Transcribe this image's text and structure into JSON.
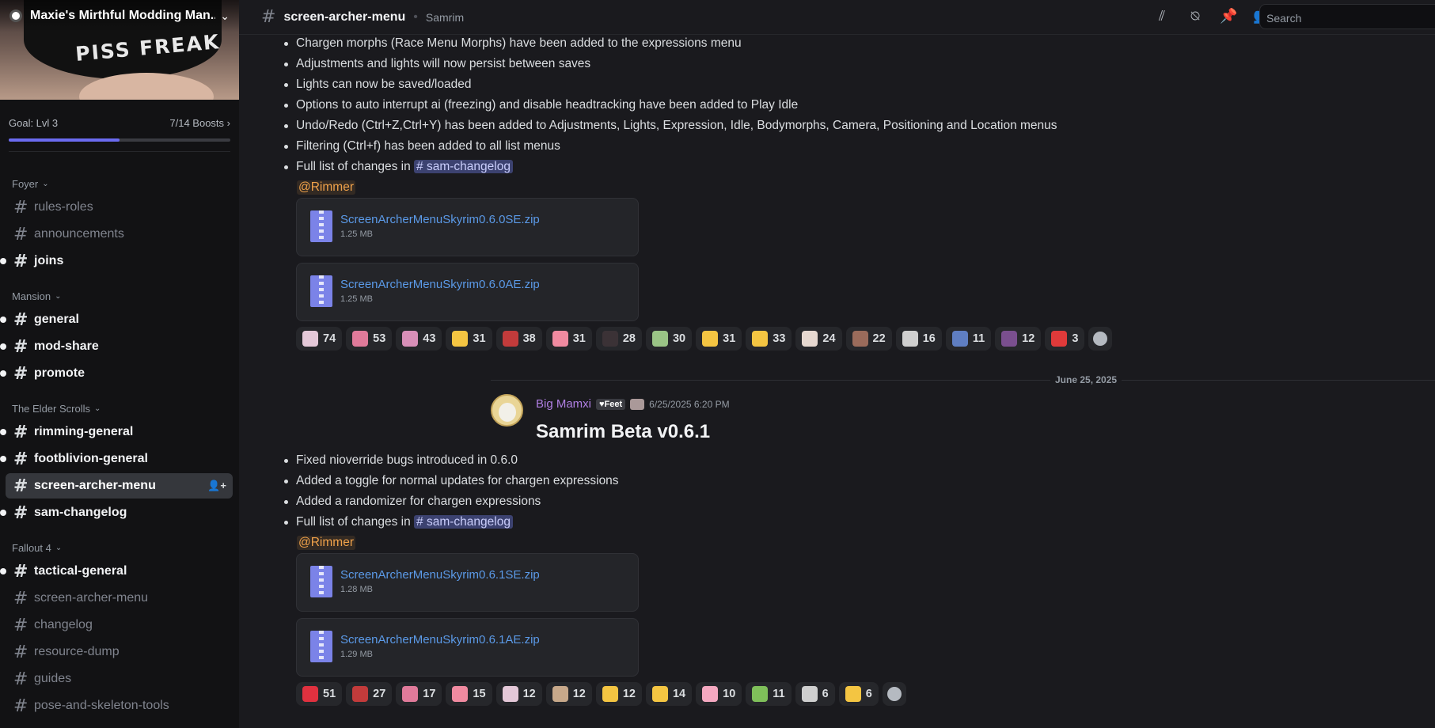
{
  "server": {
    "name": "Maxie's Mirthful Modding Man...",
    "banner_text": "PISS FREAK"
  },
  "boost": {
    "goal": "Goal: Lvl 3",
    "progress_label": "7/14 Boosts",
    "progress": 0.5
  },
  "categories": {
    "foyer": "Foyer",
    "mansion": "Mansion",
    "elder": "The Elder Scrolls",
    "fallout": "Fallout 4"
  },
  "channels": {
    "rules_roles": "rules-roles",
    "announcements": "announcements",
    "joins": "joins",
    "general": "general",
    "mod_share": "mod-share",
    "promote": "promote",
    "rimming_general": "rimming-general",
    "footblivion_general": "footblivion-general",
    "screen_archer_menu": "screen-archer-menu",
    "sam_changelog": "sam-changelog",
    "tactical_general": "tactical-general",
    "fo4_screen_archer": "screen-archer-menu",
    "changelog": "changelog",
    "resource_dump": "resource-dump",
    "guides": "guides",
    "pose_tools": "pose-and-skeleton-tools"
  },
  "header": {
    "hash": "#",
    "channel": "screen-archer-menu",
    "topic": "Samrim",
    "search_placeholder": "Search"
  },
  "post1": {
    "bullets": [
      "Chargen morphs (Race Menu Morphs) have been added to the expressions menu",
      "Adjustments and lights will now persist between saves",
      "Lights can now be saved/loaded",
      "Options to auto interrupt ai (freezing) and disable headtracking have been added to Play Idle",
      "Undo/Redo (Ctrl+Z,Ctrl+Y) has been added to Adjustments, Lights, Expression, Idle, Bodymorphs, Camera, Positioning and Location menus",
      "Filtering (Ctrl+f) has been added to all list menus"
    ],
    "changes_prefix": "Full list of changes in",
    "changelog_link": "# sam-changelog",
    "mention": "@Rimmer",
    "attachments": [
      {
        "name": "ScreenArcherMenuSkyrim0.6.0SE.zip",
        "size": "1.25 MB"
      },
      {
        "name": "ScreenArcherMenuSkyrim0.6.0AE.zip",
        "size": "1.25 MB"
      }
    ],
    "reactions": [
      {
        "icon": "anime-face-emoji",
        "count": "74",
        "color": "#e4c8d8"
      },
      {
        "icon": "anime-blush-emoji",
        "count": "53",
        "color": "#e07a9a"
      },
      {
        "icon": "anime-girl-emoji",
        "count": "43",
        "color": "#d88fb8"
      },
      {
        "icon": "crying-emoji",
        "count": "31",
        "color": "#f4c542"
      },
      {
        "icon": "lips-emoji",
        "count": "38",
        "color": "#c23b3b"
      },
      {
        "icon": "pink-cone-emoji",
        "count": "31",
        "color": "#f08aa0"
      },
      {
        "icon": "dark-face-emoji",
        "count": "28",
        "color": "#3b3236"
      },
      {
        "icon": "flower-girl-emoji",
        "count": "30",
        "color": "#9ac486"
      },
      {
        "icon": "shush-emoji",
        "count": "31",
        "color": "#f4c542"
      },
      {
        "icon": "thumbs-up-emoji",
        "count": "33",
        "color": "#f4c542"
      },
      {
        "icon": "pale-face-emoji",
        "count": "24",
        "color": "#e6d8d0"
      },
      {
        "icon": "helmet-emoji",
        "count": "22",
        "color": "#9a6b5b"
      },
      {
        "icon": "sketch-face-emoji",
        "count": "16",
        "color": "#cfcfcf"
      },
      {
        "icon": "blue-hair-emoji",
        "count": "11",
        "color": "#5f7ec2"
      },
      {
        "icon": "anime-kiss-emoji",
        "count": "12",
        "color": "#7a4f8f"
      },
      {
        "icon": "flag-emoji",
        "count": "3",
        "color": "#e03a3a"
      }
    ]
  },
  "divider_date": "June 25, 2025",
  "post2": {
    "author": "Big Mamxi",
    "tag": "♥Feet",
    "timestamp": "6/25/2025 6:20 PM",
    "title": "Samrim Beta v0.6.1",
    "bullets": [
      "Fixed nioverride bugs introduced in 0.6.0",
      "Added a toggle for normal updates for chargen expressions",
      "Added a randomizer for chargen expressions"
    ],
    "changes_prefix": "Full list of changes in",
    "changelog_link": "# sam-changelog",
    "mention": "@Rimmer",
    "attachments": [
      {
        "name": "ScreenArcherMenuSkyrim0.6.1SE.zip",
        "size": "1.28 MB"
      },
      {
        "name": "ScreenArcherMenuSkyrim0.6.1AE.zip",
        "size": "1.29 MB"
      }
    ],
    "reactions": [
      {
        "icon": "heart-emoji",
        "count": "51",
        "color": "#e0313f"
      },
      {
        "icon": "lips-emoji",
        "count": "27",
        "color": "#c23b3b"
      },
      {
        "icon": "anime-blush-emoji",
        "count": "17",
        "color": "#e07a9a"
      },
      {
        "icon": "pink-cone-emoji",
        "count": "15",
        "color": "#f08aa0"
      },
      {
        "icon": "anime-face-emoji",
        "count": "12",
        "color": "#e4c8d8"
      },
      {
        "icon": "sketch-girl-emoji",
        "count": "12",
        "color": "#c7a88a"
      },
      {
        "icon": "shades-emoji",
        "count": "12",
        "color": "#f4c542"
      },
      {
        "icon": "thumbs-up-emoji",
        "count": "14",
        "color": "#f4c542"
      },
      {
        "icon": "pink-heart-emoji",
        "count": "10",
        "color": "#f4a8c0"
      },
      {
        "icon": "green-hair-emoji",
        "count": "11",
        "color": "#7fbf5a"
      },
      {
        "icon": "sketch-face-emoji",
        "count": "6",
        "color": "#cfcfcf"
      },
      {
        "icon": "ok-hand-emoji",
        "count": "6",
        "color": "#f4c542"
      }
    ]
  }
}
